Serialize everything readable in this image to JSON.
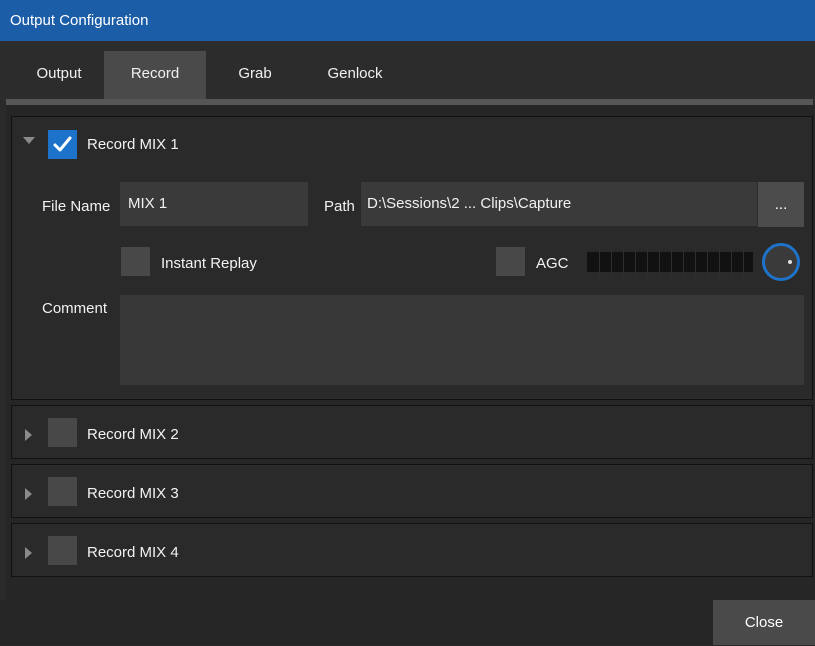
{
  "window": {
    "title": "Output Configuration"
  },
  "tabs": [
    {
      "label": "Output",
      "active": false
    },
    {
      "label": "Record",
      "active": true
    },
    {
      "label": "Grab",
      "active": false
    },
    {
      "label": "Genlock",
      "active": false
    }
  ],
  "sections": [
    {
      "label": "Record MIX 1",
      "checked": true,
      "expanded": true,
      "file_name_label": "File Name",
      "file_name_value": "MIX 1",
      "path_label": "Path",
      "path_value": "D:\\Sessions\\2 ... Clips\\Capture",
      "browse_label": "...",
      "instant_replay_label": "Instant Replay",
      "agc_label": "AGC",
      "comment_label": "Comment",
      "comment_value": ""
    },
    {
      "label": "Record MIX 2",
      "checked": false,
      "expanded": false
    },
    {
      "label": "Record MIX 3",
      "checked": false,
      "expanded": false
    },
    {
      "label": "Record MIX 4",
      "checked": false,
      "expanded": false
    }
  ],
  "footer": {
    "close_label": "Close"
  },
  "colors": {
    "accent": "#1d73c9",
    "titlebar": "#1c5da8"
  }
}
